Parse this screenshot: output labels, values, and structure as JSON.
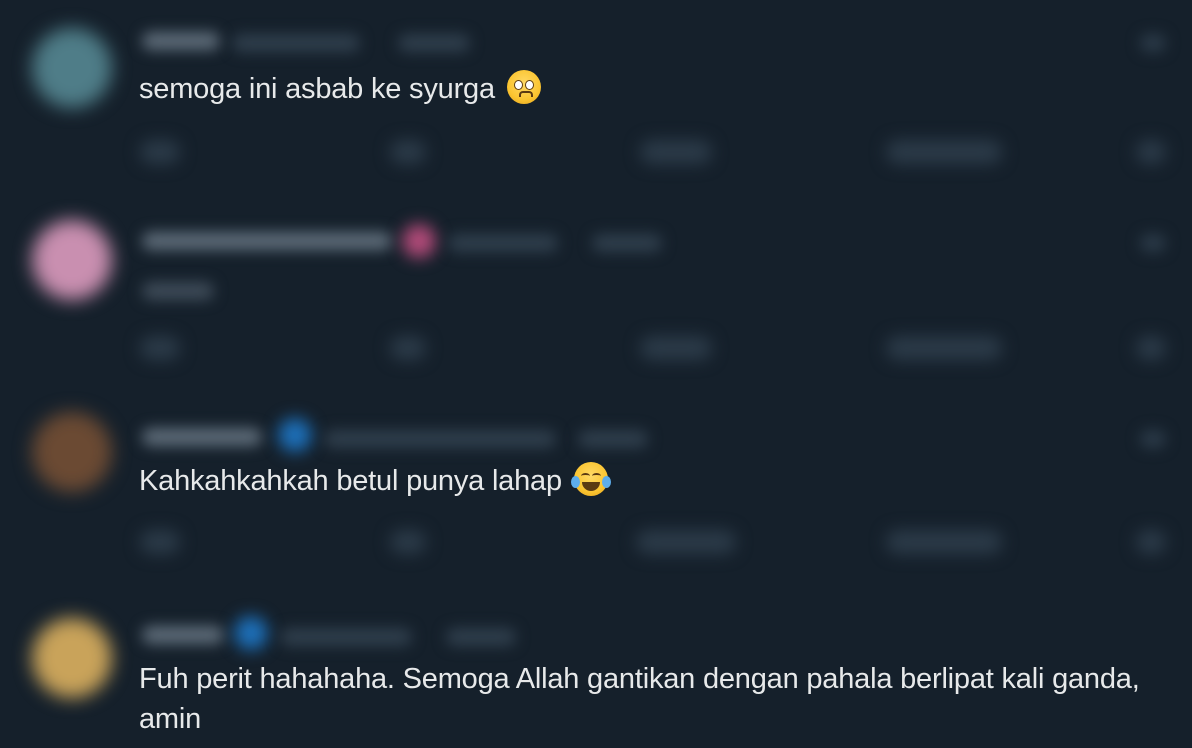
{
  "replies": [
    {
      "text": "semoga ini asbab ke syurga",
      "emoji": "pleading-face-icon"
    },
    {
      "text": "",
      "emoji": ""
    },
    {
      "text": "Kahkahkahkah betul punya lahap",
      "emoji": "face-with-tears-of-joy-icon"
    },
    {
      "text": "Fuh perit hahahaha. Semoga Allah gantikan dengan pahala berlipat kali ganda, amin",
      "emoji": ""
    }
  ],
  "colors": {
    "background": "#15202b",
    "text": "#e7e9ea"
  }
}
